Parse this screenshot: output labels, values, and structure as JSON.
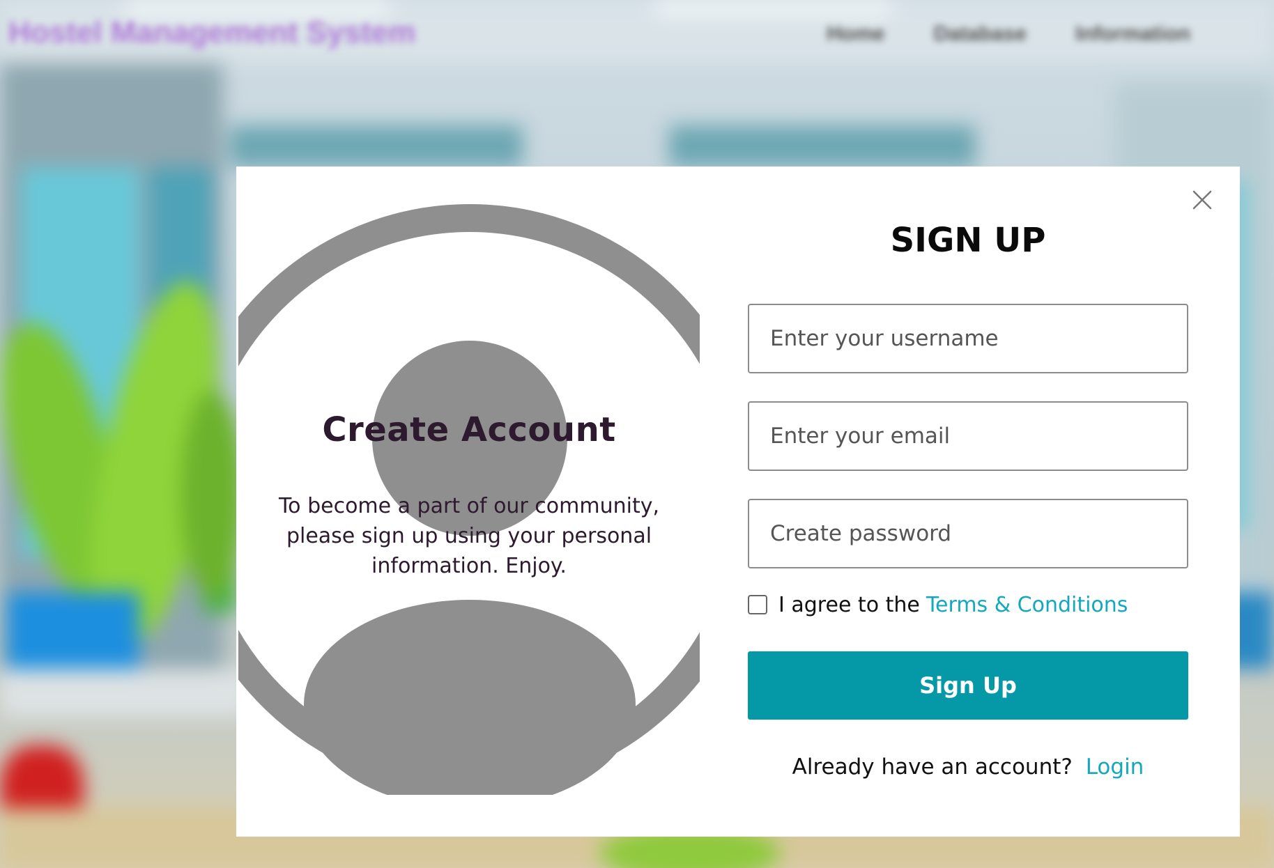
{
  "navbar": {
    "brand": "Hostel Management System",
    "links": [
      "Home",
      "Database",
      "Information"
    ]
  },
  "modal": {
    "close_icon": "close-icon",
    "left": {
      "title": "Create Account",
      "description": "To become a part of our community, please sign up using your personal information. Enjoy.",
      "graphic_icon": "user-avatar-icon"
    },
    "form": {
      "title": "SIGN UP",
      "username_placeholder": "Enter your username",
      "email_placeholder": "Enter your email",
      "password_placeholder": "Create password",
      "agree_text": "I agree to the",
      "terms_link": "Terms & Conditions",
      "agree_checked": false,
      "submit_label": "Sign Up",
      "login_prompt": "Already have an account?",
      "login_link": "Login"
    }
  },
  "colors": {
    "accent": "#0599a8",
    "link": "#13a8bd",
    "heading_dark": "#2d1a2e",
    "avatar_gray": "#8f8f8f"
  }
}
